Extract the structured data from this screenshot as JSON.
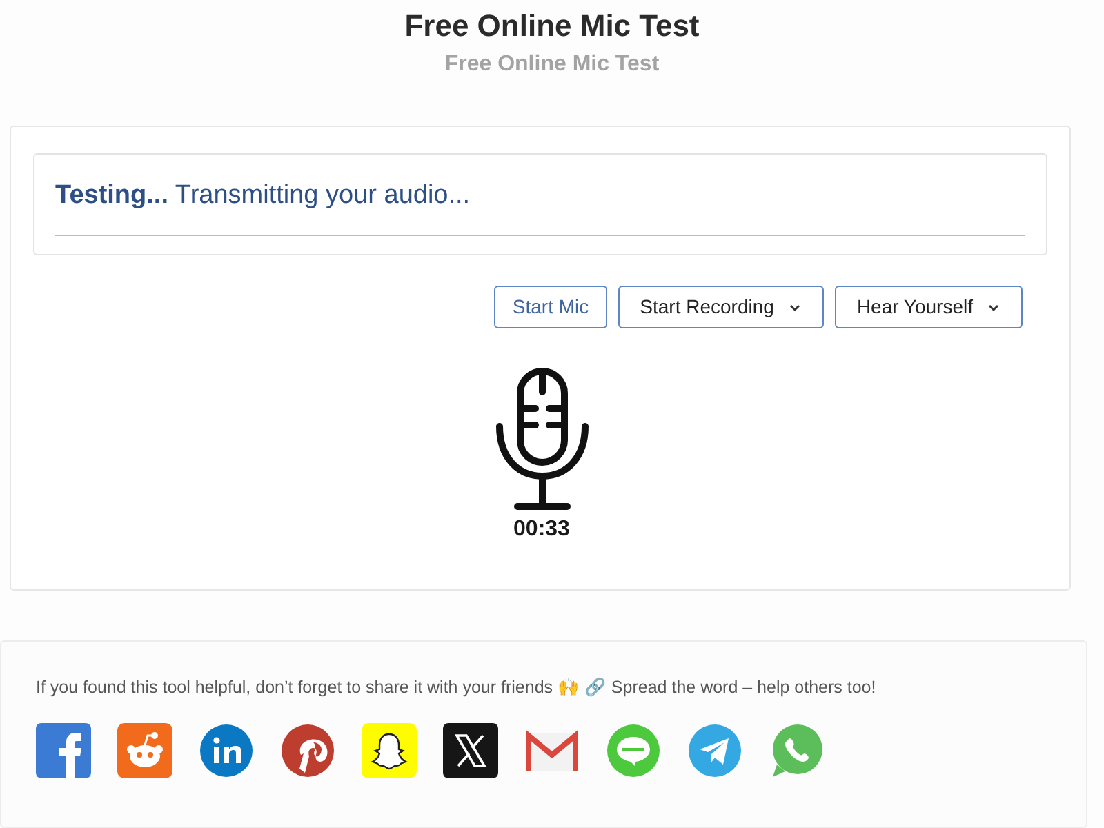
{
  "header": {
    "title": "Free Online Mic Test",
    "subtitle": "Free Online Mic Test"
  },
  "status": {
    "label": "Testing...",
    "message": "Transmitting your audio..."
  },
  "buttons": [
    {
      "label": "Start Mic",
      "kind": "button"
    },
    {
      "label": "Start Recording",
      "kind": "dropdown"
    },
    {
      "label": "Hear Yourself",
      "kind": "dropdown"
    }
  ],
  "timer": "00:33",
  "share": {
    "text": "If you found this tool helpful, don’t forget to share it  with your friends 🙌 🔗 Spread the word – help others too!",
    "networks": [
      {
        "kind": "facebook"
      },
      {
        "kind": "reddit"
      },
      {
        "kind": "linkedin"
      },
      {
        "kind": "pinterest"
      },
      {
        "kind": "snapchat"
      },
      {
        "kind": "x"
      },
      {
        "kind": "gmail"
      },
      {
        "kind": "line"
      },
      {
        "kind": "telegram"
      },
      {
        "kind": "whatsapp"
      }
    ]
  }
}
